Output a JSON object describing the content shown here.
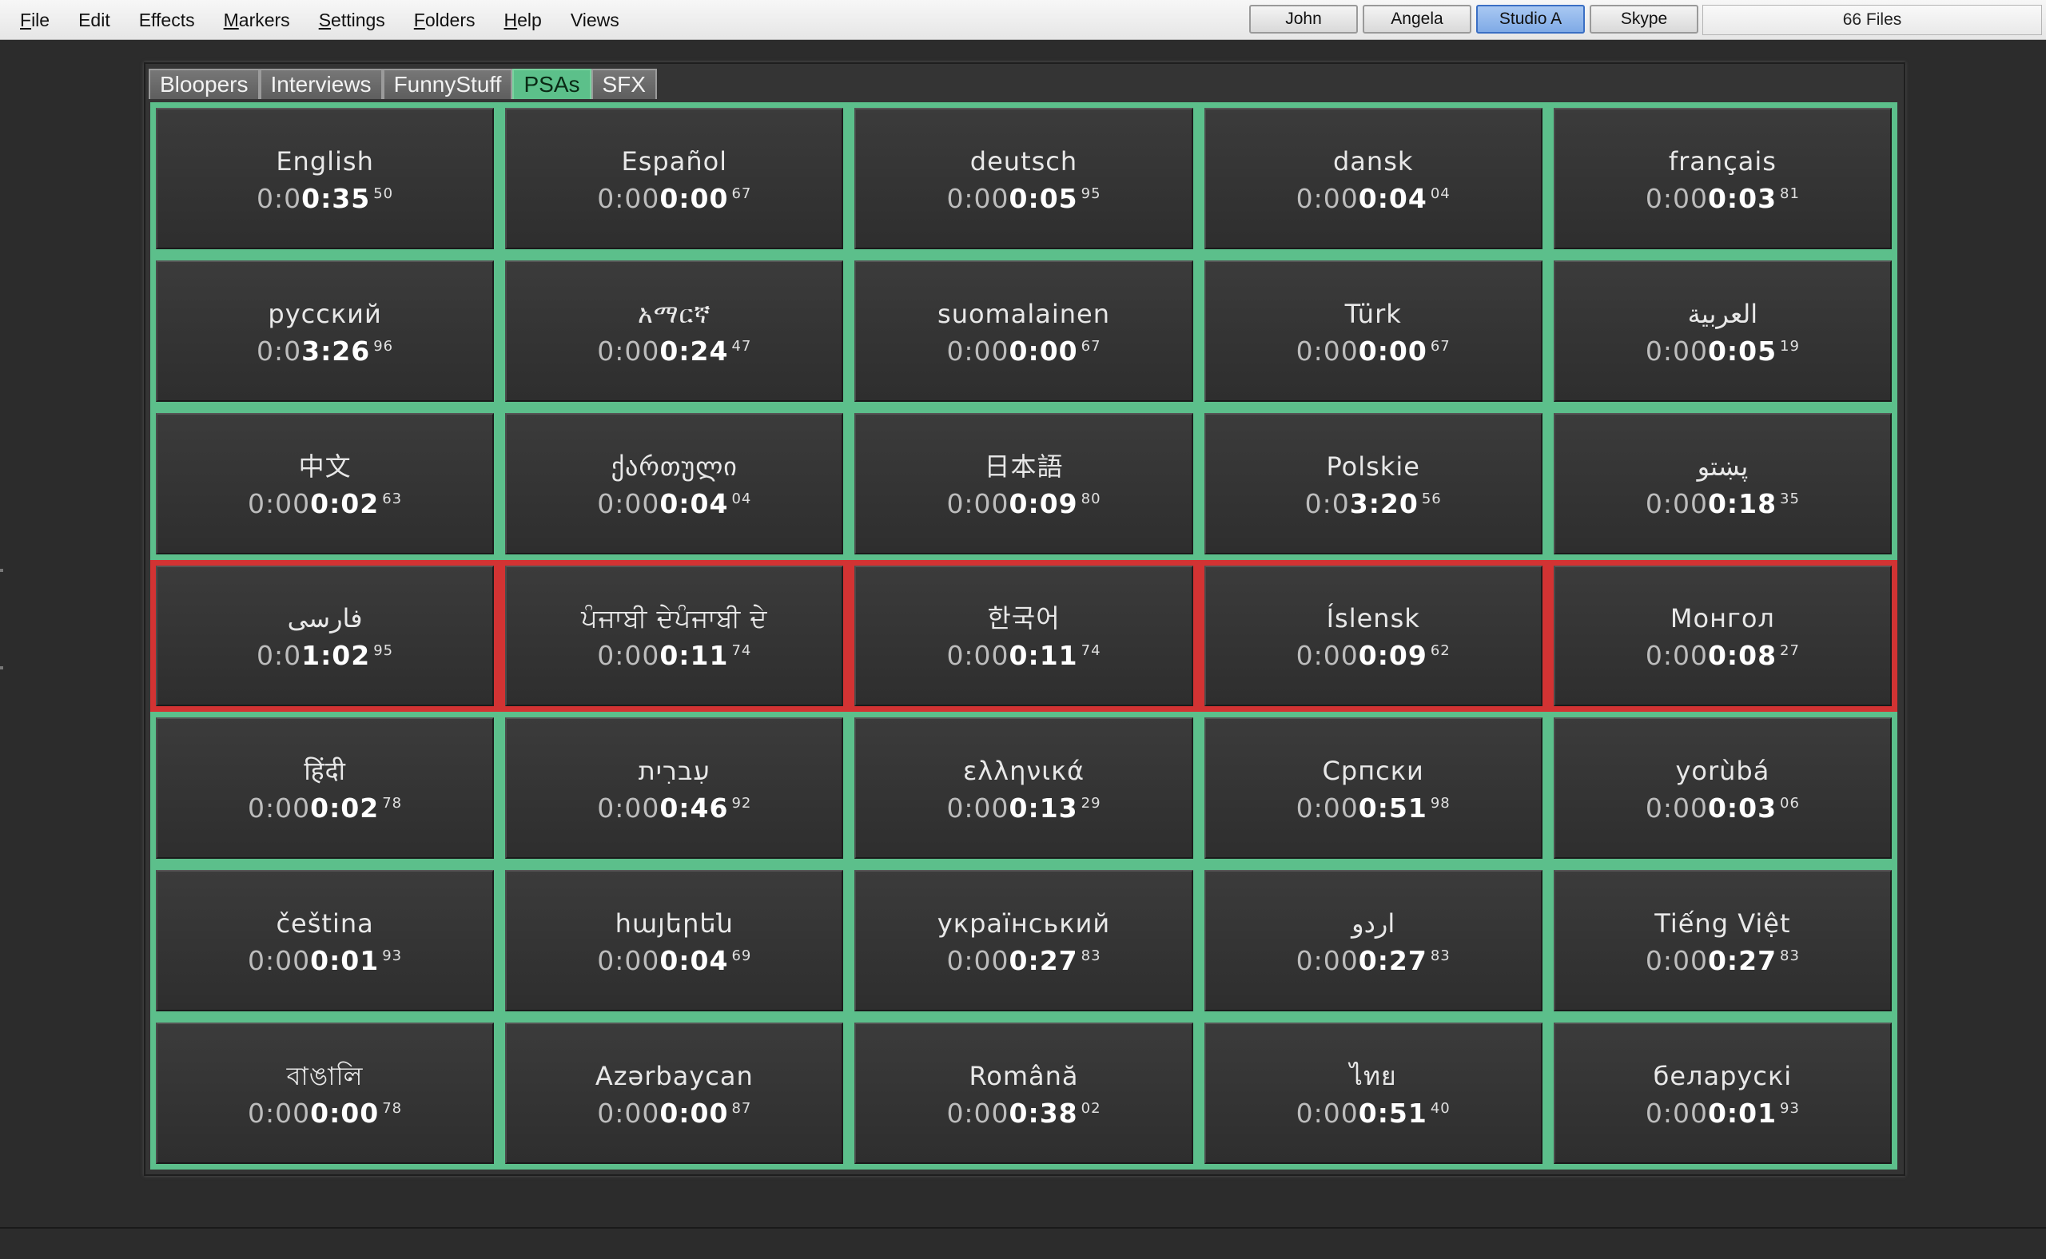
{
  "menubar": {
    "items": [
      {
        "label": "File",
        "mnemonic": "F"
      },
      {
        "label": "Edit",
        "mnemonic": ""
      },
      {
        "label": "Effects",
        "mnemonic": ""
      },
      {
        "label": "Markers",
        "mnemonic": "M"
      },
      {
        "label": "Settings",
        "mnemonic": "S"
      },
      {
        "label": "Folders",
        "mnemonic": "F"
      },
      {
        "label": "Help",
        "mnemonic": "H"
      },
      {
        "label": "Views",
        "mnemonic": ""
      }
    ],
    "users": [
      {
        "label": "John",
        "active": false
      },
      {
        "label": "Angela",
        "active": false
      },
      {
        "label": "Studio A",
        "active": true
      },
      {
        "label": "Skype",
        "active": false
      }
    ],
    "files_count": "66 Files"
  },
  "tabs": [
    {
      "label": "Bloopers",
      "active": false
    },
    {
      "label": "Interviews",
      "active": false
    },
    {
      "label": "FunnyStuff",
      "active": false
    },
    {
      "label": "PSAs",
      "active": true
    },
    {
      "label": "SFX",
      "active": false
    }
  ],
  "colors": {
    "ready": "#5cbf8b",
    "playing": "#d23333",
    "active_tab": "#5cc08a",
    "active_user": "#7faae6"
  },
  "tiles": [
    {
      "name": "English",
      "dim": "0:0",
      "strong": "0:35",
      "frac": "50",
      "state": "ready"
    },
    {
      "name": "Español",
      "dim": "0:00",
      "strong": "0:00",
      "frac": "67",
      "state": "ready"
    },
    {
      "name": "deutsch",
      "dim": "0:00",
      "strong": "0:05",
      "frac": "95",
      "state": "ready"
    },
    {
      "name": "dansk",
      "dim": "0:00",
      "strong": "0:04",
      "frac": "04",
      "state": "ready"
    },
    {
      "name": "français",
      "dim": "0:00",
      "strong": "0:03",
      "frac": "81",
      "state": "ready"
    },
    {
      "name": "русский",
      "dim": "0:0",
      "strong": "3:26",
      "frac": "96",
      "state": "ready"
    },
    {
      "name": "አማርኛ",
      "dim": "0:00",
      "strong": "0:24",
      "frac": "47",
      "state": "ready"
    },
    {
      "name": "suomalainen",
      "dim": "0:00",
      "strong": "0:00",
      "frac": "67",
      "state": "ready"
    },
    {
      "name": "Türk",
      "dim": "0:00",
      "strong": "0:00",
      "frac": "67",
      "state": "ready"
    },
    {
      "name": "العربية",
      "dim": "0:00",
      "strong": "0:05",
      "frac": "19",
      "state": "ready"
    },
    {
      "name": "中文",
      "dim": "0:00",
      "strong": "0:02",
      "frac": "63",
      "state": "ready"
    },
    {
      "name": "ქართული",
      "dim": "0:00",
      "strong": "0:04",
      "frac": "04",
      "state": "ready"
    },
    {
      "name": "日本語",
      "dim": "0:00",
      "strong": "0:09",
      "frac": "80",
      "state": "ready"
    },
    {
      "name": "Polskie",
      "dim": "0:0",
      "strong": "3:20",
      "frac": "56",
      "state": "ready"
    },
    {
      "name": "پښتو",
      "dim": "0:00",
      "strong": "0:18",
      "frac": "35",
      "state": "ready"
    },
    {
      "name": "فارسی",
      "dim": "0:0",
      "strong": "1:02",
      "frac": "95",
      "state": "playing"
    },
    {
      "name": "ਪੰਜਾਬੀ ਦੇਪੰਜਾਬੀ ਦੇ",
      "dim": "0:00",
      "strong": "0:11",
      "frac": "74",
      "state": "playing"
    },
    {
      "name": "한국어",
      "dim": "0:00",
      "strong": "0:11",
      "frac": "74",
      "state": "playing"
    },
    {
      "name": "Íslensk",
      "dim": "0:00",
      "strong": "0:09",
      "frac": "62",
      "state": "playing"
    },
    {
      "name": "Монгол",
      "dim": "0:00",
      "strong": "0:08",
      "frac": "27",
      "state": "playing"
    },
    {
      "name": "हिंदी",
      "dim": "0:00",
      "strong": "0:02",
      "frac": "78",
      "state": "ready"
    },
    {
      "name": "עִברִית",
      "dim": "0:00",
      "strong": "0:46",
      "frac": "92",
      "state": "ready"
    },
    {
      "name": "ελληνικά",
      "dim": "0:00",
      "strong": "0:13",
      "frac": "29",
      "state": "ready"
    },
    {
      "name": "Српски",
      "dim": "0:00",
      "strong": "0:51",
      "frac": "98",
      "state": "ready"
    },
    {
      "name": "yorùbá",
      "dim": "0:00",
      "strong": "0:03",
      "frac": "06",
      "state": "ready"
    },
    {
      "name": "čeština",
      "dim": "0:00",
      "strong": "0:01",
      "frac": "93",
      "state": "ready"
    },
    {
      "name": "հայերեն",
      "dim": "0:00",
      "strong": "0:04",
      "frac": "69",
      "state": "ready"
    },
    {
      "name": "український",
      "dim": "0:00",
      "strong": "0:27",
      "frac": "83",
      "state": "ready"
    },
    {
      "name": "اردو",
      "dim": "0:00",
      "strong": "0:27",
      "frac": "83",
      "state": "ready"
    },
    {
      "name": "Tiếng Việt",
      "dim": "0:00",
      "strong": "0:27",
      "frac": "83",
      "state": "ready"
    },
    {
      "name": "বাঙালি",
      "dim": "0:00",
      "strong": "0:00",
      "frac": "78",
      "state": "ready"
    },
    {
      "name": "Azərbaycan",
      "dim": "0:00",
      "strong": "0:00",
      "frac": "87",
      "state": "ready"
    },
    {
      "name": "Română",
      "dim": "0:00",
      "strong": "0:38",
      "frac": "02",
      "state": "ready"
    },
    {
      "name": "ไทย",
      "dim": "0:00",
      "strong": "0:51",
      "frac": "40",
      "state": "ready"
    },
    {
      "name": "беларускі",
      "dim": "0:00",
      "strong": "0:01",
      "frac": "93",
      "state": "ready"
    }
  ]
}
